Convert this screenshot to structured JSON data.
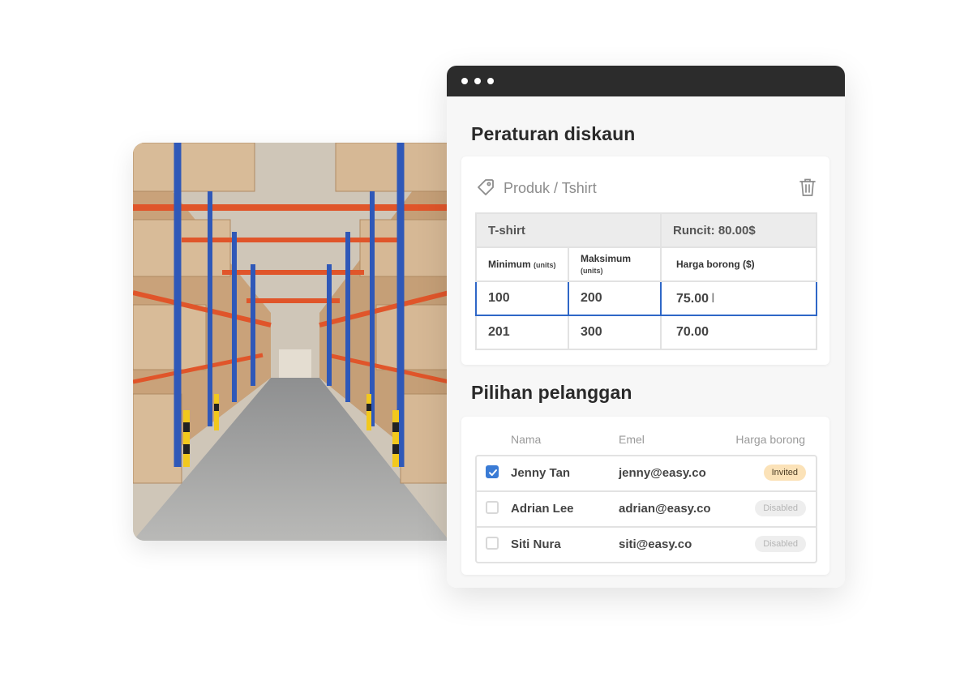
{
  "rules_section": {
    "title": "Peraturan diskaun",
    "product_label": "Produk / Tshirt",
    "table": {
      "product_name": "T-shirt",
      "retail_price": "Runcit: 80.00$",
      "columns": [
        {
          "label": "Minimum",
          "unit": "(units)"
        },
        {
          "label": "Maksimum",
          "unit": "(units)"
        },
        {
          "label": "Harga borong ($)",
          "unit": ""
        }
      ],
      "rows": [
        {
          "min": "100",
          "max": "200",
          "price": "75.00",
          "active": true
        },
        {
          "min": "201",
          "max": "300",
          "price": "70.00",
          "active": false
        }
      ]
    }
  },
  "customers_section": {
    "title": "Pilihan pelanggan",
    "columns": [
      "Nama",
      "Emel",
      "Harga borong"
    ],
    "rows": [
      {
        "name": "Jenny Tan",
        "email": "jenny@easy.co",
        "status": "Invited",
        "checked": true
      },
      {
        "name": "Adrian Lee",
        "email": "adrian@easy.co",
        "status": "Disabled",
        "checked": false
      },
      {
        "name": "Siti Nura",
        "email": "siti@easy.co",
        "status": "Disabled",
        "checked": false
      }
    ]
  },
  "colors": {
    "titlebar": "#2c2c2c",
    "accent_blue": "#2f67c7",
    "checkbox_blue": "#3a7bd5",
    "invited_badge": "#fbe2b8",
    "disabled_badge": "#eeeeee"
  },
  "icons": {
    "tag": "tag-icon",
    "trash": "trash-icon",
    "checkmark": "check-icon",
    "text_cursor": "text-cursor-icon"
  }
}
